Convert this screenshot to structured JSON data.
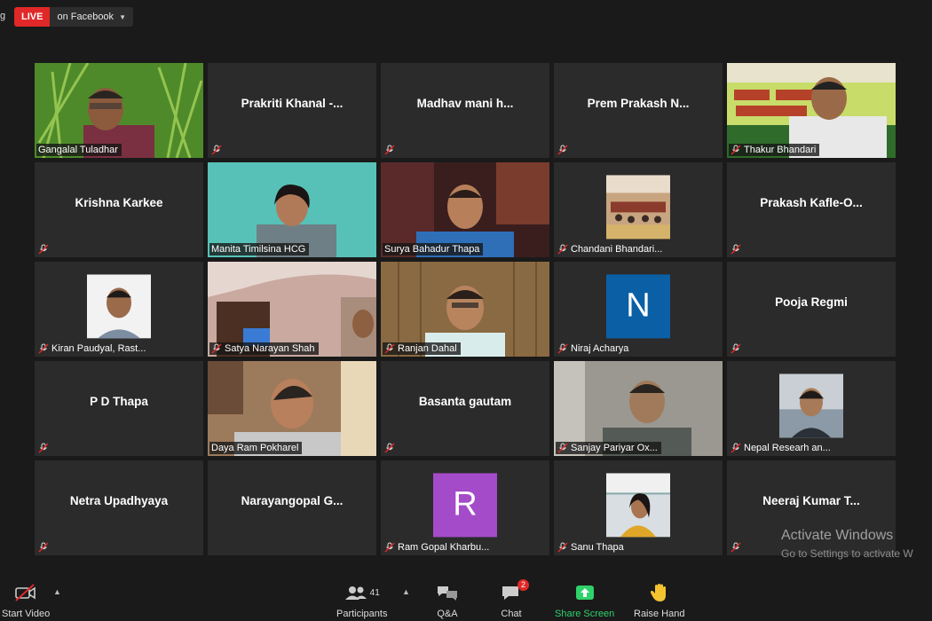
{
  "topbar": {
    "rec_fragment": "g",
    "live_label": "LIVE",
    "live_destination": "on Facebook"
  },
  "tiles": [
    {
      "name": "Gangalal Tuladhar",
      "display": ""
    },
    {
      "name": "",
      "display": "Prakriti  Khanal  -..."
    },
    {
      "name": "",
      "display": "Madhav  mani  h..."
    },
    {
      "name": "",
      "display": "Prem  Prakash  N..."
    },
    {
      "name": "Thakur Bhandari",
      "display": ""
    },
    {
      "name": "",
      "display": "Krishna Karkee"
    },
    {
      "name": "Manita Timilsina HCG",
      "display": ""
    },
    {
      "name": "Surya Bahadur Thapa",
      "display": ""
    },
    {
      "name": "Chandani Bhandari...",
      "display": ""
    },
    {
      "name": "",
      "display": "Prakash  Kafle-O..."
    },
    {
      "name": "Kiran Paudyal, Rast...",
      "display": ""
    },
    {
      "name": "Satya Narayan Shah",
      "display": ""
    },
    {
      "name": "Ranjan Dahal",
      "display": ""
    },
    {
      "name": "Niraj Acharya",
      "display": "",
      "avatar_letter": "N",
      "avatar_color": "#0b5fa5"
    },
    {
      "name": "",
      "display": "Pooja Regmi"
    },
    {
      "name": "",
      "display": "P D Thapa"
    },
    {
      "name": "Daya Ram Pokharel",
      "display": ""
    },
    {
      "name": "",
      "display": "Basanta gautam"
    },
    {
      "name": "Sanjay Pariyar    Ox...",
      "display": ""
    },
    {
      "name": "Nepal Researh an...",
      "display": ""
    },
    {
      "name": "",
      "display": "Netra Upadhyaya"
    },
    {
      "name": "",
      "display": "Narayangopal  G..."
    },
    {
      "name": "Ram Gopal Kharbu...",
      "display": "",
      "avatar_letter": "R",
      "avatar_color": "#a44bc9"
    },
    {
      "name": "Sanu Thapa",
      "display": ""
    },
    {
      "name": "",
      "display": "Neeraj  Kumar  T..."
    }
  ],
  "watermark": {
    "line1": "Activate Windows",
    "line2": "Go to Settings to activate W"
  },
  "toolbar": {
    "start_video": "Start Video",
    "participants": "Participants",
    "participants_count": "41",
    "qa": "Q&A",
    "chat": "Chat",
    "chat_badge": "2",
    "share_screen": "Share Screen",
    "raise_hand": "Raise Hand"
  },
  "colors": {
    "live": "#e02828",
    "active_speaker": "#d9e35f",
    "share_green": "#2fd26b",
    "tile_bg": "#2b2b2b"
  }
}
